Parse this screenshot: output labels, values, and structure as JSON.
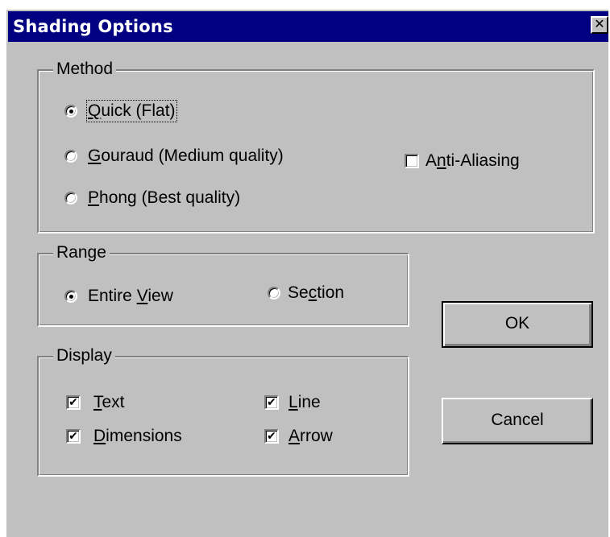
{
  "window": {
    "title": "Shading Options",
    "close_glyph": "✕"
  },
  "method": {
    "label": "Method",
    "options": [
      {
        "text": "Quick (Flat)",
        "mnemonic": "Q",
        "checked": true
      },
      {
        "text": "Gouraud (Medium quality)",
        "mnemonic": "G",
        "checked": false
      },
      {
        "text": "Phong (Best quality)",
        "mnemonic": "P",
        "checked": false
      }
    ],
    "anti_aliasing": {
      "text": "Anti-Aliasing",
      "mnemonic": "n",
      "checked": false
    }
  },
  "range": {
    "label": "Range",
    "options": [
      {
        "text": "Entire View",
        "mnemonic": "V",
        "checked": true
      },
      {
        "text": "Section",
        "mnemonic": "c",
        "checked": false
      }
    ]
  },
  "display": {
    "label": "Display",
    "items": [
      {
        "text": "Text",
        "mnemonic": "T",
        "checked": true
      },
      {
        "text": "Line",
        "mnemonic": "L",
        "checked": true
      },
      {
        "text": "Dimensions",
        "mnemonic": "D",
        "checked": true
      },
      {
        "text": "Arrow",
        "mnemonic": "A",
        "checked": true
      }
    ]
  },
  "buttons": {
    "ok": "OK",
    "cancel": "Cancel"
  },
  "colors": {
    "titlebar": "#000080",
    "face": "#c0c0c0"
  },
  "icons": {
    "close": "close-icon",
    "radio_on": "radio-checked-icon",
    "check_on": "checkmark-icon"
  }
}
